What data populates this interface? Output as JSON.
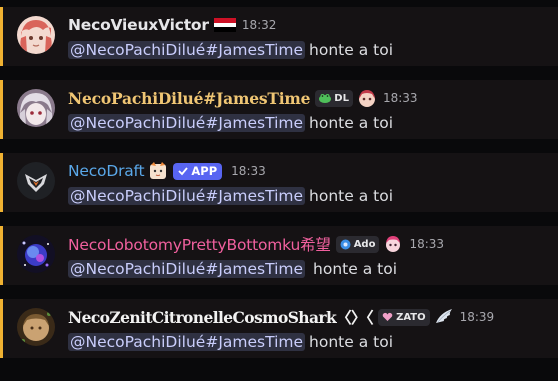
{
  "messages": [
    {
      "username": "NecoVieuxVictor",
      "name_color": "#e6e6e9",
      "flag_colors": [
        "#ce1126",
        "#ffffff",
        "#000000"
      ],
      "time": "18:32",
      "mention": "@NecoPachiDilué#JamesTime",
      "text": "honte a toi"
    },
    {
      "username": "NecoPachiDilué#JamesTime",
      "name_color": "#f0c674",
      "tag": "DL",
      "time": "18:33",
      "mention": "@NecoPachiDilué#JamesTime",
      "text": "honte a toi"
    },
    {
      "username": "NecoDraft",
      "name_color": "#5aa7e8",
      "app_badge": "APP",
      "time": "18:33",
      "mention": "@NecoPachiDilué#JamesTime",
      "text": "honte a toi"
    },
    {
      "username": "NecoLobotomyPrettyBottomku希望",
      "name_color": "#f0609e",
      "tag": "Ado",
      "time": "18:33",
      "mention": "@NecoPachiDilué#JamesTime",
      "text": "honte a toi"
    },
    {
      "username": "NecoZenitCitronelleCosmoShark〈〉〈",
      "name_color": "#f2f2f2",
      "tag": "ZATO",
      "time": "18:39",
      "mention": "@NecoPachiDilué#JamesTime",
      "text": "honte a toi"
    }
  ],
  "colors": {
    "highlight_bar": "#f0b232",
    "mention_bg": "#2f3142",
    "app_badge": "#5865f2"
  }
}
